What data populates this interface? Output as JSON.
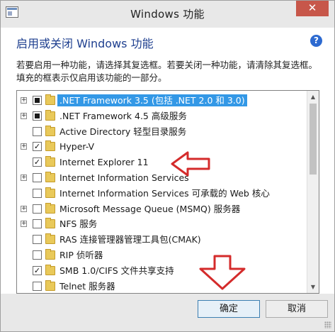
{
  "window": {
    "title": "Windows 功能",
    "close_label": "✕"
  },
  "header": {
    "title": "启用或关闭 Windows 功能",
    "help_label": "?"
  },
  "description": "若要启用一种功能，请选择其复选框。若要关闭一种功能，请清除其复选框。填充的框表示仅启用该功能的一部分。",
  "features": [
    {
      "label": ".NET Framework 3.5 (包括 .NET 2.0 和 3.0)",
      "expander": "+",
      "state": "partial",
      "selected": true
    },
    {
      "label": ".NET Framework 4.5 高级服务",
      "expander": "+",
      "state": "partial",
      "selected": false
    },
    {
      "label": "Active Directory 轻型目录服务",
      "expander": "",
      "state": "unchecked",
      "selected": false
    },
    {
      "label": "Hyper-V",
      "expander": "+",
      "state": "checked",
      "selected": false
    },
    {
      "label": "Internet Explorer 11",
      "expander": "",
      "state": "checked",
      "selected": false
    },
    {
      "label": "Internet Information Services",
      "expander": "+",
      "state": "unchecked",
      "selected": false
    },
    {
      "label": "Internet Information Services 可承载的 Web 核心",
      "expander": "",
      "state": "unchecked",
      "selected": false
    },
    {
      "label": "Microsoft Message Queue (MSMQ) 服务器",
      "expander": "+",
      "state": "unchecked",
      "selected": false
    },
    {
      "label": "NFS 服务",
      "expander": "+",
      "state": "unchecked",
      "selected": false
    },
    {
      "label": "RAS 连接管理器管理工具包(CMAK)",
      "expander": "",
      "state": "unchecked",
      "selected": false
    },
    {
      "label": "RIP 侦听器",
      "expander": "",
      "state": "unchecked",
      "selected": false
    },
    {
      "label": "SMB 1.0/CIFS 文件共享支持",
      "expander": "",
      "state": "checked",
      "selected": false
    },
    {
      "label": "Telnet 服务器",
      "expander": "",
      "state": "unchecked",
      "selected": false
    }
  ],
  "check_glyph": "✓",
  "scrollbar": {
    "up": "▲",
    "down": "▼"
  },
  "buttons": {
    "ok": "确定",
    "cancel": "取消"
  },
  "colors": {
    "accent": "#3398e6",
    "header_text": "#1e3f8f",
    "annotation_arrow": "#d42b2b",
    "close_button": "#c7574a"
  }
}
